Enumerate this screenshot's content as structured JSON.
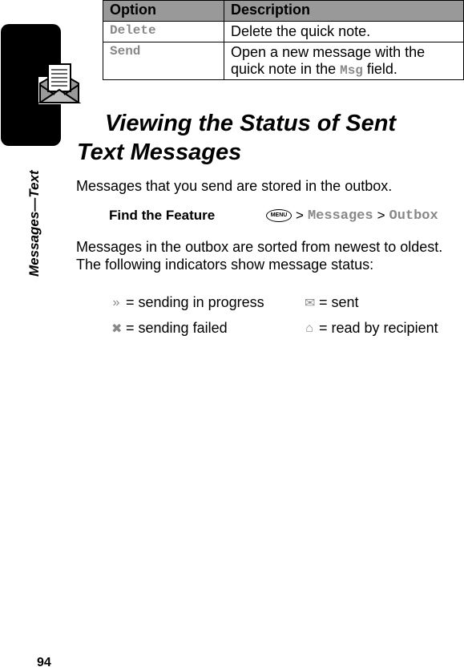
{
  "side_tab": {
    "label": "Messages—Text",
    "icon": "envelope-letter-icon"
  },
  "options_table": {
    "headers": [
      "Option",
      "Description"
    ],
    "rows": [
      {
        "option": "Delete",
        "description": "Delete the quick note."
      },
      {
        "option": "Send",
        "description_pre": "Open a new message with the quick note in the ",
        "description_code": "Msg",
        "description_post": " field."
      }
    ]
  },
  "section": {
    "title_line1": "Viewing the Status of Sent",
    "title_line2": "Text Messages",
    "intro": "Messages that you send are stored in the outbox.",
    "find_feature_label": "Find the Feature",
    "menu_key": "MENU",
    "path": [
      "Messages",
      "Outbox"
    ],
    "path_separator": ">",
    "body_line1": "Messages in the outbox are sorted from newest to oldest.",
    "body_line2": "The following indicators show message status:"
  },
  "indicators": [
    {
      "icon": "sending-in-progress-icon",
      "glyph": "»",
      "label": "= sending in progress"
    },
    {
      "icon": "sent-icon",
      "glyph": "✉",
      "label": "= sent"
    },
    {
      "icon": "sending-failed-icon",
      "glyph": "✖",
      "label": "= sending failed"
    },
    {
      "icon": "read-by-recipient-icon",
      "glyph": "⌂",
      "label": "= read by recipient"
    }
  ],
  "page_number": "94"
}
